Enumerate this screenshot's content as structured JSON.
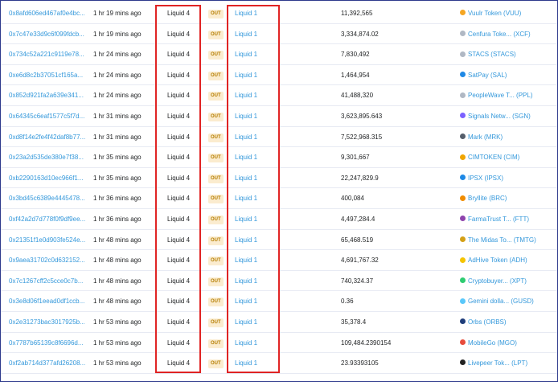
{
  "transfers": [
    {
      "hash": "0x8afd606ed467af0e4bc...",
      "age": "1 hr 19 mins ago",
      "from": "Liquid 4",
      "direction": "OUT",
      "to": "Liquid 1",
      "quantity": "11,392,565",
      "token": "Vuulr Token (VUU)",
      "icon": "vuulr-token-icon",
      "color": "#f5a623"
    },
    {
      "hash": "0x7c47e33d9c6f099fdcb...",
      "age": "1 hr 19 mins ago",
      "from": "Liquid 4",
      "direction": "OUT",
      "to": "Liquid 1",
      "quantity": "3,334,874.02",
      "token": "Cenfura Toke... (XCF)",
      "icon": "cenfura-token-icon",
      "color": "#b0b8c4"
    },
    {
      "hash": "0x734c52a221c9119e78...",
      "age": "1 hr 24 mins ago",
      "from": "Liquid 4",
      "direction": "OUT",
      "to": "Liquid 1",
      "quantity": "7,830,492",
      "token": "STACS (STACS)",
      "icon": "stacs-token-icon",
      "color": "#b0b8c4"
    },
    {
      "hash": "0xe6d8c2b37051cf165a...",
      "age": "1 hr 24 mins ago",
      "from": "Liquid 4",
      "direction": "OUT",
      "to": "Liquid 1",
      "quantity": "1,464,954",
      "token": "SatPay (SAL)",
      "icon": "satpay-token-icon",
      "color": "#1e88e5"
    },
    {
      "hash": "0x852d921fa2a639e341...",
      "age": "1 hr 24 mins ago",
      "from": "Liquid 4",
      "direction": "OUT",
      "to": "Liquid 1",
      "quantity": "41,488,320",
      "token": "PeopleWave T... (PPL)",
      "icon": "peoplewave-token-icon",
      "color": "#b0b8c4"
    },
    {
      "hash": "0x64345c6eaf1577c5f7d...",
      "age": "1 hr 31 mins ago",
      "from": "Liquid 4",
      "direction": "OUT",
      "to": "Liquid 1",
      "quantity": "3,623,895.643",
      "token": "Signals Netw... (SGN)",
      "icon": "signals-token-icon",
      "color": "#7b61ff"
    },
    {
      "hash": "0xd8f14e2fe4f42daf8b77...",
      "age": "1 hr 31 mins ago",
      "from": "Liquid 4",
      "direction": "OUT",
      "to": "Liquid 1",
      "quantity": "7,522,968.315",
      "token": "Mark (MRK)",
      "icon": "mark-token-icon",
      "color": "#555e6b"
    },
    {
      "hash": "0x23a2d535de380e7f38...",
      "age": "1 hr 35 mins ago",
      "from": "Liquid 4",
      "direction": "OUT",
      "to": "Liquid 1",
      "quantity": "9,301,667",
      "token": "CIMTOKEN (CIM)",
      "icon": "cimtoken-icon",
      "color": "#f0a500"
    },
    {
      "hash": "0xb2290163d10ec966f1...",
      "age": "1 hr 35 mins ago",
      "from": "Liquid 4",
      "direction": "OUT",
      "to": "Liquid 1",
      "quantity": "22,247,829.9",
      "token": "IPSX (IPSX)",
      "icon": "ipsx-token-icon",
      "color": "#1e88e5"
    },
    {
      "hash": "0x3bd45c6389e4445478...",
      "age": "1 hr 36 mins ago",
      "from": "Liquid 4",
      "direction": "OUT",
      "to": "Liquid 1",
      "quantity": "400,084",
      "token": "Bryllite (BRC)",
      "icon": "bryllite-token-icon",
      "color": "#f08c00"
    },
    {
      "hash": "0xf42a2d7d778f0f9df9ee...",
      "age": "1 hr 36 mins ago",
      "from": "Liquid 4",
      "direction": "OUT",
      "to": "Liquid 1",
      "quantity": "4,497,284.4",
      "token": "FarmaTrust T... (FTT)",
      "icon": "farmatrust-token-icon",
      "color": "#8e44ad"
    },
    {
      "hash": "0x21351f1e0d903fe524e...",
      "age": "1 hr 48 mins ago",
      "from": "Liquid 4",
      "direction": "OUT",
      "to": "Liquid 1",
      "quantity": "65,468.519",
      "token": "The Midas To... (TMTG)",
      "icon": "midas-token-icon",
      "color": "#d4a017"
    },
    {
      "hash": "0x9aea31702c0d632152...",
      "age": "1 hr 48 mins ago",
      "from": "Liquid 4",
      "direction": "OUT",
      "to": "Liquid 1",
      "quantity": "4,691,767.32",
      "token": "AdHive Token (ADH)",
      "icon": "adhive-token-icon",
      "color": "#f5c400"
    },
    {
      "hash": "0x7c1267cff2c5cce0c7b...",
      "age": "1 hr 48 mins ago",
      "from": "Liquid 4",
      "direction": "OUT",
      "to": "Liquid 1",
      "quantity": "740,324.37",
      "token": "Cryptobuyer... (XPT)",
      "icon": "cryptobuyer-token-icon",
      "color": "#2ecc71"
    },
    {
      "hash": "0x3e8d06f1eead0df1ccb...",
      "age": "1 hr 48 mins ago",
      "from": "Liquid 4",
      "direction": "OUT",
      "to": "Liquid 1",
      "quantity": "0.36",
      "token": "Gemini dolla... (GUSD)",
      "icon": "gemini-dollar-icon",
      "color": "#5ac8fa"
    },
    {
      "hash": "0x2e31273bac3017925b...",
      "age": "1 hr 53 mins ago",
      "from": "Liquid 4",
      "direction": "OUT",
      "to": "Liquid 1",
      "quantity": "35,378.4",
      "token": "Orbs (ORBS)",
      "icon": "orbs-token-icon",
      "color": "#1f3d7a"
    },
    {
      "hash": "0x7787b65139c8f6696d...",
      "age": "1 hr 53 mins ago",
      "from": "Liquid 4",
      "direction": "OUT",
      "to": "Liquid 1",
      "quantity": "109,484.2390154",
      "token": "MobileGo (MGO)",
      "icon": "mobilego-token-icon",
      "color": "#e74c3c"
    },
    {
      "hash": "0xf2ab714d377afd26208...",
      "age": "1 hr 53 mins ago",
      "from": "Liquid 4",
      "direction": "OUT",
      "to": "Liquid 1",
      "quantity": "23.93393105",
      "token": "Livepeer Tok... (LPT)",
      "icon": "livepeer-token-icon",
      "color": "#222222"
    }
  ]
}
